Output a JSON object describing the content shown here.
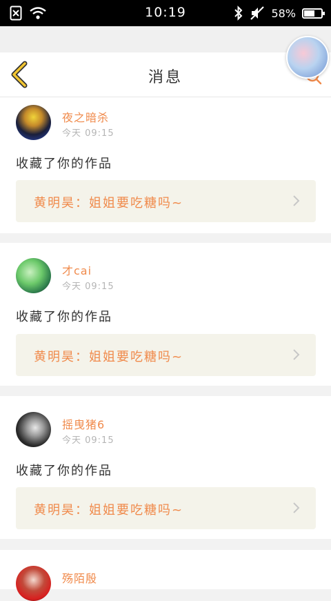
{
  "status_bar": {
    "time": "10:19",
    "battery": "58%",
    "battery_level": 0.58,
    "icons": [
      "sim-off-icon",
      "wifi-icon",
      "bluetooth-icon",
      "mute-icon",
      "battery-icon"
    ]
  },
  "header": {
    "title": "消息",
    "back_icon": "chevron-left-icon"
  },
  "colors": {
    "accent": "#f08a4b",
    "back_arrow": "#f2c531",
    "quote_bg": "#f4f3ea"
  },
  "messages": [
    {
      "user": "夜之暗杀",
      "time": "今天 09:15",
      "action": "收藏了你的作品",
      "quote": "黄明昊：姐姐要吃糖吗~"
    },
    {
      "user": "才cai",
      "time": "今天 09:15",
      "action": "收藏了你的作品",
      "quote": "黄明昊：姐姐要吃糖吗~"
    },
    {
      "user": "摇曳猪6",
      "time": "今天 09:15",
      "action": "收藏了你的作品",
      "quote": "黄明昊：姐姐要吃糖吗~"
    },
    {
      "user": "殇陌殷",
      "time": "",
      "action": "",
      "quote": ""
    }
  ]
}
